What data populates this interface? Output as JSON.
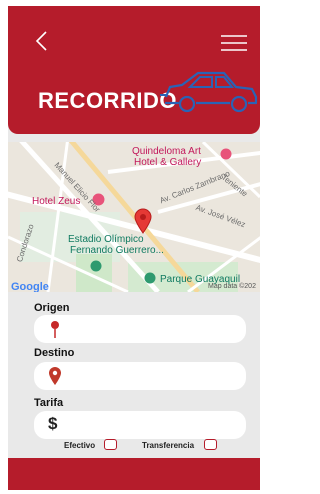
{
  "header": {
    "title": "RECORRIDO",
    "back_icon": "chevron-left-icon",
    "menu_icon": "hamburger-menu-icon",
    "car_icon": "car-outline-icon"
  },
  "map": {
    "places": {
      "hotel_quindeloma_line1": "Quindeloma Art",
      "hotel_quindeloma_line2": "Hotel & Gallery",
      "hotel_zeus": "Hotel Zeus",
      "estadio_line1": "Estadio Olímpico",
      "estadio_line2": "Fernando Guerrero...",
      "parque": "Parque Guayaquil"
    },
    "streets": {
      "manuel_elicio": "Manuel Elicio Flor",
      "carlos_zambrano": "Av. Carlos Zambrano",
      "jose_velez": "Av. José Vélez",
      "condorazo": "Condorazo",
      "teniente": "Teniente"
    },
    "attribution": "Google",
    "map_data": "Map data ©202"
  },
  "form": {
    "origin_label": "Origen",
    "destination_label": "Destino",
    "fare_label": "Tarifa",
    "fare_symbol": "$",
    "cash_label": "Efectivo",
    "transfer_label": "Transferencia"
  },
  "colors": {
    "primary": "#b51c2b",
    "car_outline": "#2a63b6"
  }
}
